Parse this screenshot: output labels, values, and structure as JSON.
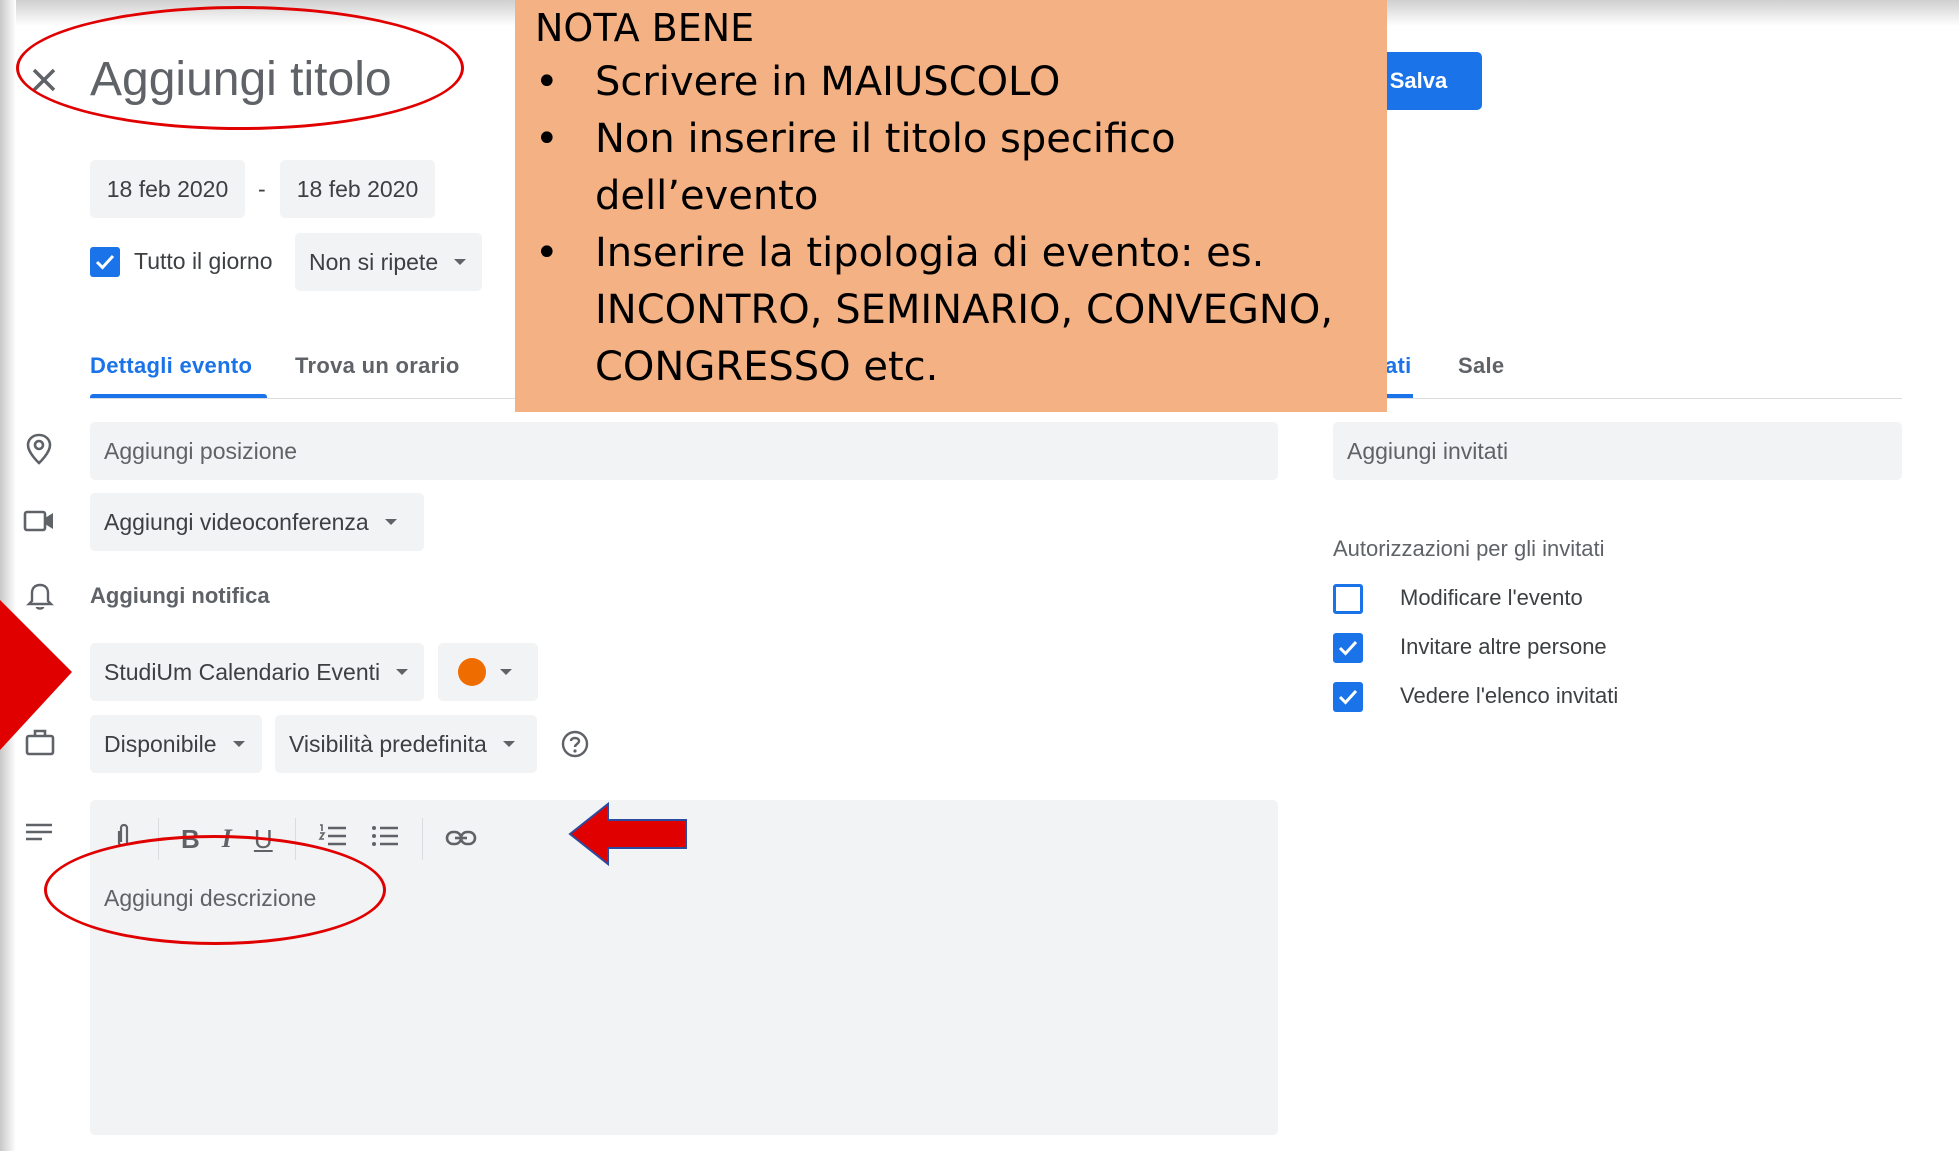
{
  "header": {
    "close_icon": "close-icon",
    "title_placeholder": "Aggiungi titolo",
    "save_label": "Salva"
  },
  "dates": {
    "start": "18 feb 2020",
    "separator": "-",
    "end": "18 feb 2020"
  },
  "allday": {
    "label": "Tutto il giorno",
    "checked": true
  },
  "repeat": {
    "value": "Non si ripete"
  },
  "tabs": [
    {
      "label": "Dettagli evento",
      "active": true
    },
    {
      "label": "Trova un orario",
      "active": false
    },
    {
      "label": "Invitati",
      "visible_fragment": "ati",
      "active": true
    },
    {
      "label": "Sale",
      "active": false
    }
  ],
  "details": {
    "location_placeholder": "Aggiungi posizione",
    "videoconf_label": "Aggiungi videoconferenza",
    "notification_label": "Aggiungi notifica",
    "calendar_value": "StudiUm Calendario Eventi",
    "event_color": "#ef6c00",
    "availability_value": "Disponibile",
    "visibility_value": "Visibilità predefinita",
    "description_placeholder": "Aggiungi descrizione"
  },
  "guests": {
    "input_placeholder": "Aggiungi invitati",
    "permissions_title": "Autorizzazioni per gli invitati",
    "permissions": [
      {
        "label": "Modificare l'evento",
        "checked": false
      },
      {
        "label": "Invitare altre persone",
        "checked": true
      },
      {
        "label": "Vedere l'elenco invitati",
        "checked": true
      }
    ]
  },
  "note": {
    "title": "NOTA BENE",
    "items": [
      "Scrivere in MAIUSCOLO",
      "Non inserire il titolo specifico dell’evento",
      "Inserire la tipologia di evento: es. INCONTRO, SEMINARIO, CONVEGNO, CONGRESSO etc."
    ]
  },
  "colors": {
    "accent": "#1a73e8",
    "annotation_red": "#e00000",
    "note_background": "#f4b183"
  }
}
